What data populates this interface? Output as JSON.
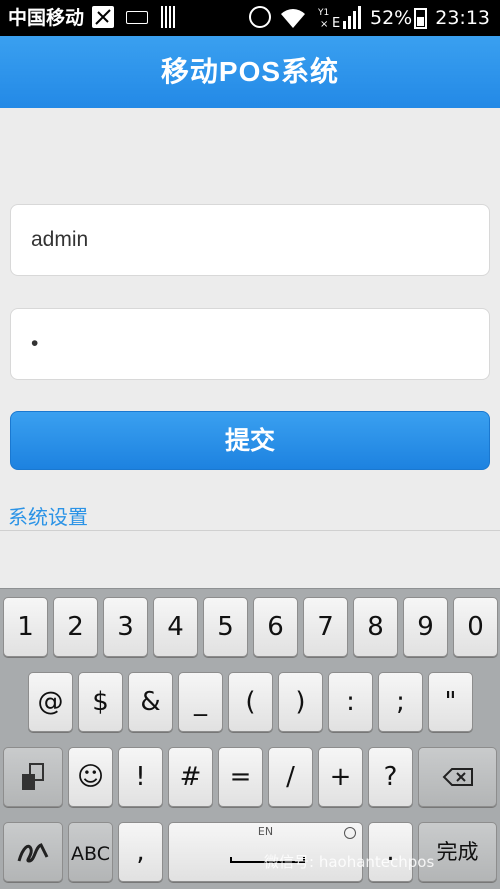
{
  "status_bar": {
    "carrier": "中国移动",
    "battery_percent": "52%",
    "time": "23:13"
  },
  "app": {
    "title": "移动POS系统"
  },
  "login": {
    "username_value": "admin",
    "password_value": "•",
    "submit_label": "提交",
    "settings_link": "系统设置"
  },
  "keyboard": {
    "row1": [
      "1",
      "2",
      "3",
      "4",
      "5",
      "6",
      "7",
      "8",
      "9",
      "0"
    ],
    "row2": [
      "@",
      "$",
      "&",
      "_",
      "(",
      ")",
      ":",
      ";",
      "\""
    ],
    "row3": [
      "☺",
      "!",
      "#",
      "=",
      "/",
      "+",
      "?"
    ],
    "abc_label": "ABC",
    "comma": ",",
    "period": ".",
    "lang": "EN",
    "done_label": "完成",
    "icons": {
      "symbols": "symbols-toggle-icon",
      "backspace": "backspace-icon",
      "handwriting": "handwriting-icon",
      "globe": "globe-icon"
    }
  },
  "watermark": "微信号: haohantechpos"
}
